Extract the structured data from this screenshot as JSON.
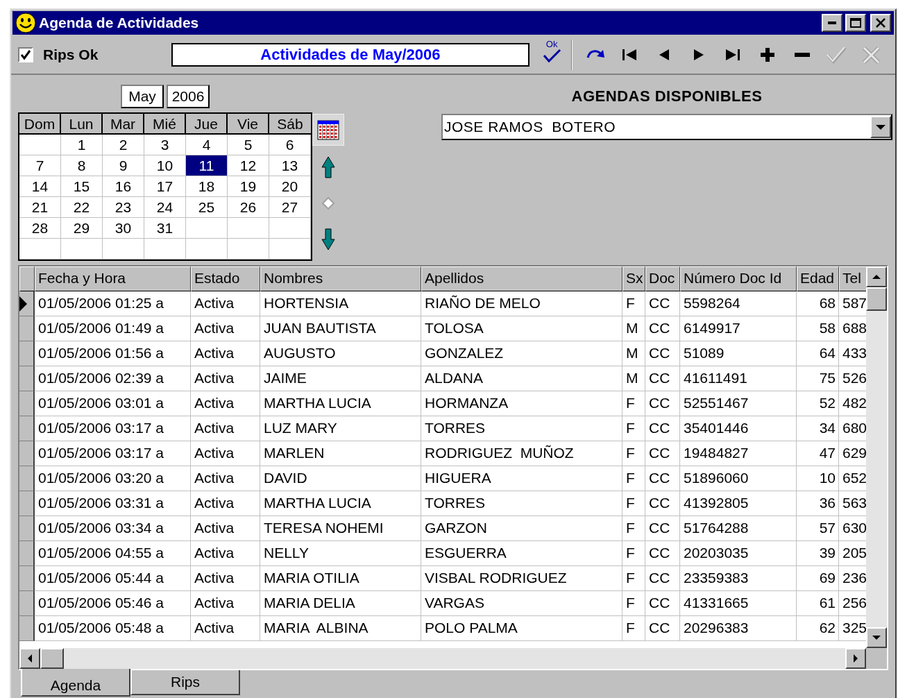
{
  "window": {
    "title": "Agenda de Actividades"
  },
  "toolbar": {
    "rips_ok": {
      "label": "Rips Ok",
      "checked": true
    },
    "caption": "Actividades de May/2006",
    "ok_button": {
      "label": "Ok"
    },
    "buttons": [
      {
        "kind": "refresh",
        "disabled": false
      },
      {
        "kind": "first",
        "disabled": false
      },
      {
        "kind": "prior",
        "disabled": false
      },
      {
        "kind": "next",
        "disabled": false
      },
      {
        "kind": "last",
        "disabled": false
      },
      {
        "kind": "insert",
        "disabled": false
      },
      {
        "kind": "delete",
        "disabled": false
      },
      {
        "kind": "post",
        "disabled": true
      },
      {
        "kind": "cancel",
        "disabled": true
      }
    ]
  },
  "calendar": {
    "month": "May",
    "year": "2006",
    "weekdays": [
      "Dom",
      "Lun",
      "Mar",
      "Mié",
      "Jue",
      "Vie",
      "Sáb"
    ],
    "weeks": [
      {
        "kind": "leading",
        "days": [
          {
            "day": "1",
            "selected": false
          },
          {
            "day": "2",
            "selected": false
          },
          {
            "day": "3",
            "selected": false
          },
          {
            "day": "4",
            "selected": false
          },
          {
            "day": "5",
            "selected": false
          },
          {
            "day": "6",
            "selected": false
          }
        ]
      },
      {
        "kind": "full",
        "days": [
          {
            "day": "7",
            "selected": false
          },
          {
            "day": "8",
            "selected": false
          },
          {
            "day": "9",
            "selected": false
          },
          {
            "day": "10",
            "selected": false
          },
          {
            "day": "11",
            "selected": true
          },
          {
            "day": "12",
            "selected": false
          },
          {
            "day": "13",
            "selected": false
          }
        ]
      },
      {
        "kind": "full",
        "days": [
          {
            "day": "14",
            "selected": false
          },
          {
            "day": "15",
            "selected": false
          },
          {
            "day": "16",
            "selected": false
          },
          {
            "day": "17",
            "selected": false
          },
          {
            "day": "18",
            "selected": false
          },
          {
            "day": "19",
            "selected": false
          },
          {
            "day": "20",
            "selected": false
          }
        ]
      },
      {
        "kind": "full",
        "days": [
          {
            "day": "21",
            "selected": false
          },
          {
            "day": "22",
            "selected": false
          },
          {
            "day": "23",
            "selected": false
          },
          {
            "day": "24",
            "selected": false
          },
          {
            "day": "25",
            "selected": false
          },
          {
            "day": "26",
            "selected": false
          },
          {
            "day": "27",
            "selected": false
          }
        ]
      },
      {
        "kind": "trailing",
        "days": [
          {
            "day": "28",
            "selected": false
          },
          {
            "day": "29",
            "selected": false
          },
          {
            "day": "30",
            "selected": false
          },
          {
            "day": "31",
            "selected": false
          }
        ]
      },
      {
        "kind": "blank"
      }
    ]
  },
  "agendas": {
    "label": "AGENDAS DISPONIBLES",
    "value": "JOSE RAMOS  BOTERO"
  },
  "table": {
    "columns": [
      "Fecha y Hora",
      "Estado",
      "Nombres",
      "Apellidos",
      "Sx",
      "Doc",
      "Número Doc Id",
      "Edad",
      "Tel"
    ],
    "rows": [
      {
        "current": true,
        "cells": [
          "01/05/2006 01:25 a",
          "Activa",
          "HORTENSIA",
          "RIAÑO DE MELO",
          "F",
          "CC",
          "5598264",
          "68",
          "587"
        ]
      },
      {
        "current": false,
        "cells": [
          "01/05/2006 01:49 a",
          "Activa",
          "JUAN BAUTISTA",
          "TOLOSA",
          "M",
          "CC",
          "6149917",
          "58",
          "688"
        ]
      },
      {
        "current": false,
        "cells": [
          "01/05/2006 01:56 a",
          "Activa",
          "AUGUSTO",
          "GONZALEZ",
          "M",
          "CC",
          "51089",
          "64",
          "433"
        ]
      },
      {
        "current": false,
        "cells": [
          "01/05/2006 02:39 a",
          "Activa",
          "JAIME",
          "ALDANA",
          "M",
          "CC",
          "41611491",
          "75",
          "526"
        ]
      },
      {
        "current": false,
        "cells": [
          "01/05/2006 03:01 a",
          "Activa",
          "MARTHA LUCIA",
          "HORMANZA",
          "F",
          "CC",
          "52551467",
          "52",
          "482"
        ]
      },
      {
        "current": false,
        "cells": [
          "01/05/2006 03:17 a",
          "Activa",
          "LUZ MARY",
          "TORRES",
          "F",
          "CC",
          "35401446",
          "34",
          "680"
        ]
      },
      {
        "current": false,
        "cells": [
          "01/05/2006 03:17 a",
          "Activa",
          "MARLEN",
          "RODRIGUEZ  MUÑOZ",
          "F",
          "CC",
          "19484827",
          "47",
          "629"
        ]
      },
      {
        "current": false,
        "cells": [
          "01/05/2006 03:20 a",
          "Activa",
          "DAVID",
          "HIGUERA",
          "F",
          "CC",
          "51896060",
          "10",
          "652"
        ]
      },
      {
        "current": false,
        "cells": [
          "01/05/2006 03:31 a",
          "Activa",
          "MARTHA LUCIA",
          "TORRES",
          "F",
          "CC",
          "41392805",
          "36",
          "563"
        ]
      },
      {
        "current": false,
        "cells": [
          "01/05/2006 03:34 a",
          "Activa",
          "TERESA NOHEMI",
          "GARZON",
          "F",
          "CC",
          "51764288",
          "57",
          "630"
        ]
      },
      {
        "current": false,
        "cells": [
          "01/05/2006 04:55 a",
          "Activa",
          "NELLY",
          "ESGUERRA",
          "F",
          "CC",
          "20203035",
          "39",
          "205"
        ]
      },
      {
        "current": false,
        "cells": [
          "01/05/2006 05:44 a",
          "Activa",
          "MARIA OTILIA",
          "VISBAL RODRIGUEZ",
          "F",
          "CC",
          "23359383",
          "69",
          "236"
        ]
      },
      {
        "current": false,
        "cells": [
          "01/05/2006 05:46 a",
          "Activa",
          "MARIA DELIA",
          "VARGAS",
          "F",
          "CC",
          "41331665",
          "61",
          "256"
        ]
      },
      {
        "current": false,
        "cells": [
          "01/05/2006 05:48 a",
          "Activa",
          "MARIA  ALBINA",
          "POLO PALMA",
          "F",
          "CC",
          "20296383",
          "62",
          "325"
        ]
      }
    ]
  },
  "tabs": [
    {
      "label": "Agenda",
      "selected": true
    },
    {
      "label": "Rips",
      "selected": false
    }
  ]
}
